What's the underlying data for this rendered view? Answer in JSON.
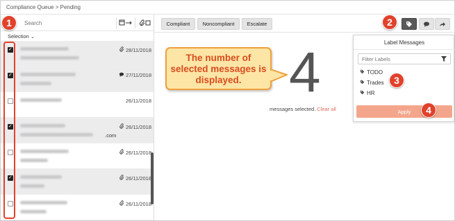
{
  "breadcrumb": "Compliance Queue > Pending",
  "search": {
    "placeholder": "Search"
  },
  "selection_label": "Selection",
  "messages": [
    {
      "selected": true,
      "icon": "paperclip-icon",
      "date": "28/11/2018",
      "extra": ""
    },
    {
      "selected": true,
      "icon": "comment-icon",
      "date": "27/11/2018",
      "extra": ""
    },
    {
      "selected": false,
      "icon": "",
      "date": "26/11/2018",
      "extra": ""
    },
    {
      "selected": true,
      "icon": "paperclip-icon",
      "date": "26/11/2018",
      "extra": ".com"
    },
    {
      "selected": false,
      "icon": "paperclip-icon",
      "date": "26/11/2018",
      "extra": ""
    },
    {
      "selected": true,
      "icon": "paperclip-icon",
      "date": "26/11/2018",
      "extra": ""
    },
    {
      "selected": false,
      "icon": "paperclip-icon",
      "date": "26/11/2018",
      "extra": ""
    }
  ],
  "toolbar": {
    "compliant": "Compliant",
    "noncompliant": "Noncompliant",
    "escalate": "Escalate"
  },
  "selected_count": "4",
  "selected_text": "messages selected.",
  "clear_all": "Clear all",
  "callout": "The number of selected messages is displayed.",
  "label_menu": {
    "title": "Label Messages",
    "filter_placeholder": "Filter Labels",
    "labels": [
      "TODO",
      "Trades",
      "HR"
    ],
    "apply": "Apply"
  },
  "badges": [
    "1",
    "2",
    "3",
    "4"
  ],
  "colors": {
    "badge": "#e2412b",
    "apply": "#f4a68c",
    "clear_all": "#e06c5a",
    "callout_bg": "#fde5a6",
    "callout_text": "#d84c1e"
  }
}
